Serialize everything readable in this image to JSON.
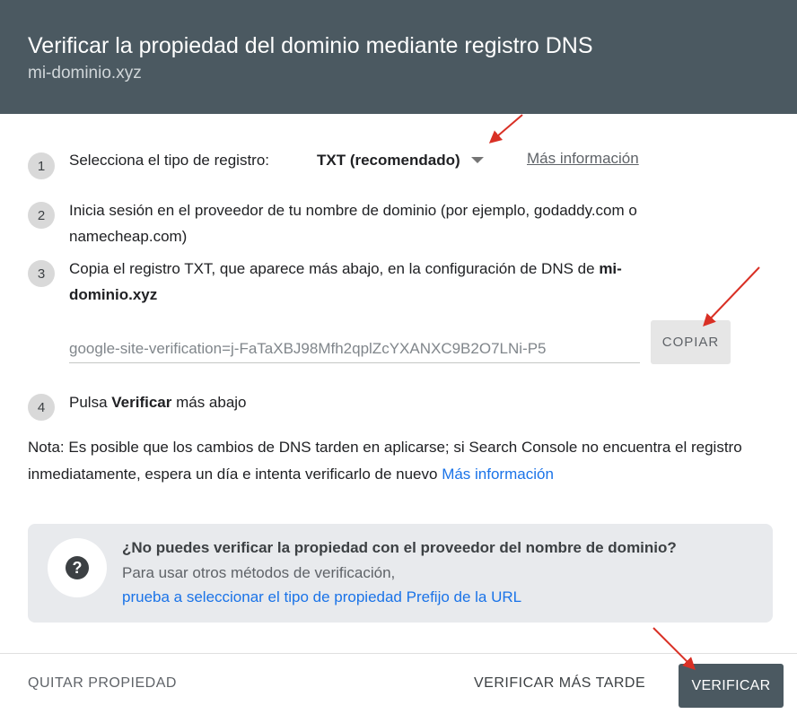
{
  "header": {
    "title": "Verificar la propiedad del dominio mediante registro DNS",
    "subtitle": "mi-dominio.xyz"
  },
  "steps": {
    "s1": {
      "num": "1",
      "label": "Selecciona el tipo de registro:",
      "select_value": "TXT (recomendado)",
      "more_info": "Más información"
    },
    "s2": {
      "num": "2",
      "line1": "Inicia sesión en el proveedor de tu nombre de dominio (por ejemplo, godaddy.com o",
      "line2": "namecheap.com)"
    },
    "s3": {
      "num": "3",
      "line1_prefix": "Copia el registro TXT, que aparece más abajo, en la configuración de DNS de ",
      "line1_bold": "mi-",
      "line2_bold": "dominio.xyz",
      "record_value": "google-site-verification=j-FaTaXBJ98Mfh2qplZcYXANXC9B2O7LNi-P5",
      "copy_label": "COPIAR"
    },
    "s4": {
      "num": "4",
      "prefix": "Pulsa ",
      "bold": "Verificar",
      "suffix": " más abajo"
    }
  },
  "note": {
    "text": "Nota: Es posible que los cambios de DNS tarden en aplicarse; si Search Console no encuentra el registro inmediatamente, espera un día e intenta verificarlo de nuevo ",
    "link": "Más información"
  },
  "info_box": {
    "title": "¿No puedes verificar la propiedad con el proveedor del nombre de dominio?",
    "line": "Para usar otros métodos de verificación,",
    "link": "prueba a seleccionar el tipo de propiedad Prefijo de la URL"
  },
  "footer": {
    "remove_label": "QUITAR PROPIEDAD",
    "later_label": "VERIFICAR MÁS TARDE",
    "verify_label": "VERIFICAR"
  },
  "colors": {
    "header_bg": "#4b5961",
    "link_blue": "#1a73e8",
    "annotation_red": "#d93025"
  }
}
